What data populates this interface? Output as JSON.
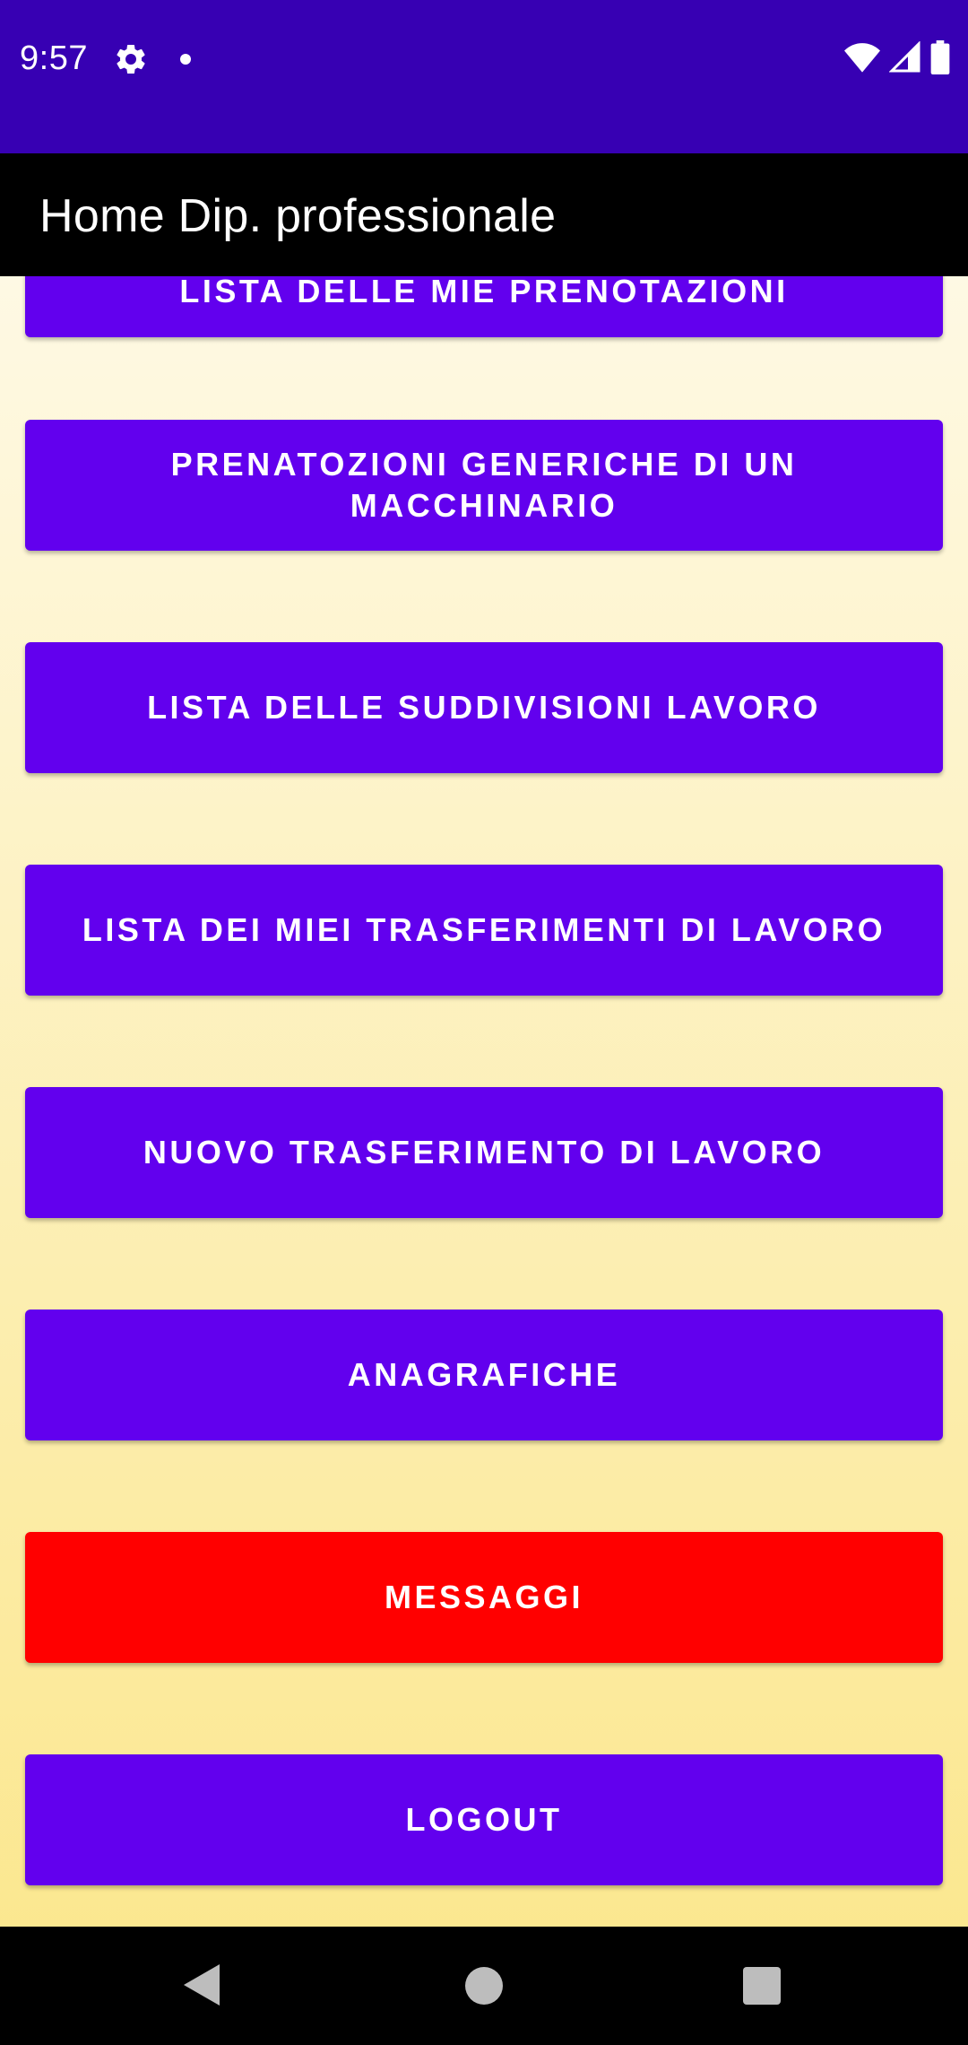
{
  "status_bar": {
    "time": "9:57",
    "icons": [
      "gear-icon",
      "notification-dot-icon",
      "wifi-icon",
      "signal-icon",
      "battery-icon"
    ],
    "background": "#3700b3"
  },
  "app_bar": {
    "title": "Home Dip. professionale",
    "background": "#000000"
  },
  "buttons": [
    {
      "label": "LISTA DELLE MIE PRENOTAZIONI",
      "color": "#6200ee",
      "partially_visible": true
    },
    {
      "label": "PRENATOZIONI GENERICHE DI UN MACCHINARIO",
      "color": "#6200ee"
    },
    {
      "label": "LISTA DELLE SUDDIVISIONI LAVORO",
      "color": "#6200ee"
    },
    {
      "label": "LISTA DEI MIEI TRASFERIMENTI DI LAVORO",
      "color": "#6200ee"
    },
    {
      "label": "NUOVO TRASFERIMENTO DI LAVORO",
      "color": "#6200ee"
    },
    {
      "label": "ANAGRAFICHE",
      "color": "#6200ee"
    },
    {
      "label": "MESSAGGI",
      "color": "#ff0000"
    },
    {
      "label": "LOGOUT",
      "color": "#6200ee"
    }
  ],
  "nav_bar": {
    "icons": [
      "back-icon",
      "home-icon",
      "recents-icon"
    ]
  }
}
